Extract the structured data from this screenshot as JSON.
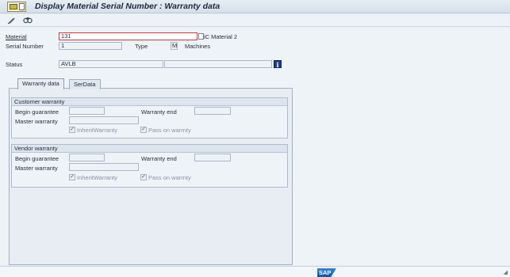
{
  "window": {
    "title": "Display Material Serial Number : Warranty data"
  },
  "header": {
    "material_label": "Material",
    "material_value": "131",
    "material_desc": "iC Material 2",
    "serial_label": "Serial Number",
    "serial_value": "1",
    "type_label": "Type",
    "type_value": "M",
    "type_desc": "Machines",
    "status_label": "Status",
    "status_value": "AVLB",
    "info_icon": "i"
  },
  "tabs": [
    {
      "label": "Warranty data",
      "active": true
    },
    {
      "label": "SerData",
      "active": false
    }
  ],
  "customer_warranty": {
    "title": "Customer warranty",
    "begin_label": "Begin guarantee",
    "begin_value": "",
    "end_label": "Warranty end",
    "end_value": "",
    "master_label": "Master warranty",
    "master_value": "",
    "inherit_label": "InheritWarranty",
    "inherit_checked": true,
    "pass_label": "Pass on warrnty",
    "pass_checked": true
  },
  "vendor_warranty": {
    "title": "Vendor warranty",
    "begin_label": "Begin guarantee",
    "begin_value": "",
    "end_label": "Warranty end",
    "end_value": "",
    "master_label": "Master warranty",
    "master_value": "",
    "inherit_label": "InheritWarranty",
    "inherit_checked": true,
    "pass_label": "Pass on warrnty",
    "pass_checked": true
  },
  "statusbar": {
    "logo": "SAP"
  },
  "icons": {
    "toolbar": [
      "edit-icon",
      "find-icon"
    ]
  },
  "colors": {
    "background": "#eef3f8",
    "required_border": "#c03c3c",
    "sap_blue": "#0d5aa6"
  }
}
